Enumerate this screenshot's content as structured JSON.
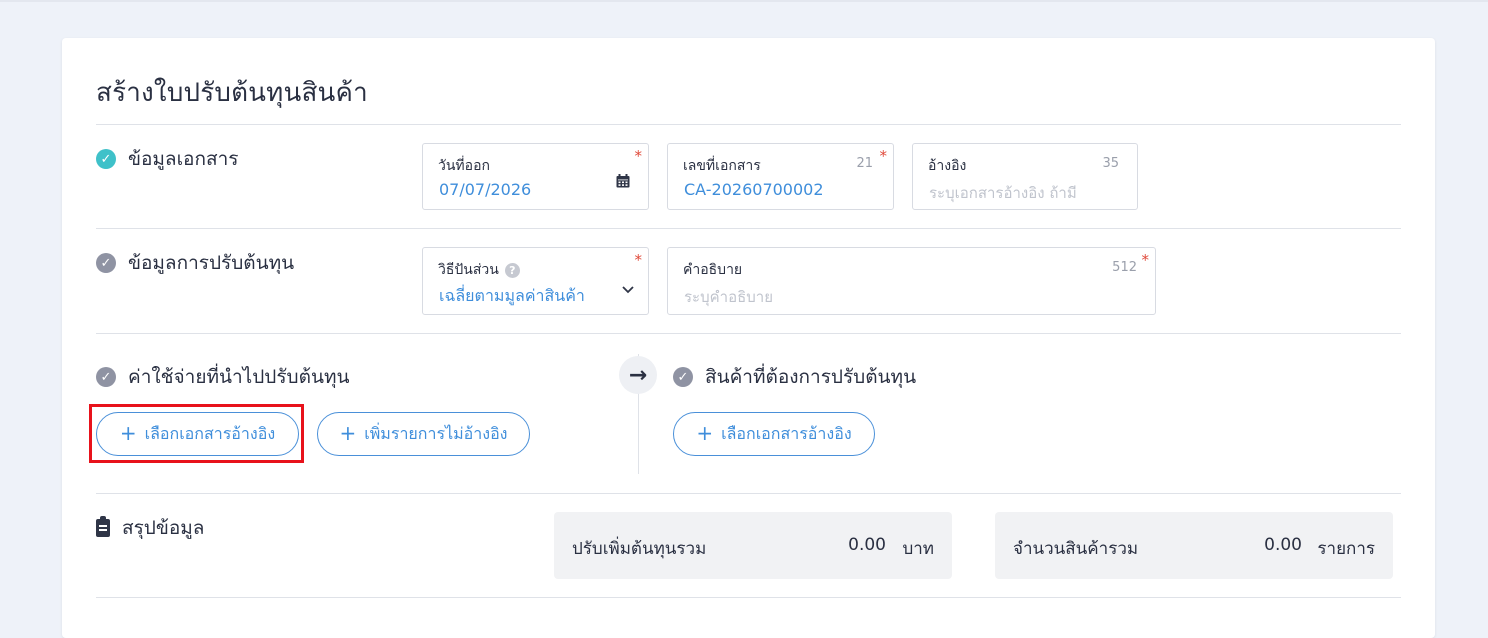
{
  "page": {
    "title": "สร้างใบปรับต้นทุนสินค้า"
  },
  "sections": {
    "document_info": {
      "label": "ข้อมูลเอกสาร",
      "status": "complete"
    },
    "adjust_info": {
      "label": "ข้อมูลการปรับต้นทุน",
      "status": "pending"
    },
    "expenses": {
      "label": "ค่าใช้จ่ายที่นำไปปรับต้นทุน",
      "status": "pending"
    },
    "products": {
      "label": "สินค้าที่ต้องการปรับต้นทุน",
      "status": "pending"
    },
    "summary": {
      "label": "สรุปข้อมูล"
    }
  },
  "fields": {
    "issue_date": {
      "label": "วันที่ออก",
      "value": "07/07/2026",
      "required": "*"
    },
    "doc_number": {
      "label": "เลขที่เอกสาร",
      "value": "CA-20260700002",
      "counter": "21",
      "required": "*"
    },
    "reference": {
      "label": "อ้างอิง",
      "placeholder": "ระบุเอกสารอ้างอิง ถ้ามี",
      "counter": "35"
    },
    "allocation_method": {
      "label": "วิธีปันส่วน",
      "value": "เฉลี่ยตามมูลค่าสินค้า",
      "required": "*"
    },
    "description": {
      "label": "คำอธิบาย",
      "placeholder": "ระบุคำอธิบาย",
      "counter": "512",
      "required": "*"
    }
  },
  "buttons": {
    "select_ref_doc": "เลือกเอกสารอ้างอิง",
    "add_unreferenced": "เพิ่มรายการไม่อ้างอิง",
    "select_ref_doc_products": "เลือกเอกสารอ้างอิง",
    "plus": "+"
  },
  "summary": {
    "total_increase": {
      "label": "ปรับเพิ่มต้นทุนรวม",
      "value": "0.00",
      "unit": "บาท"
    },
    "total_items": {
      "label": "จำนวนสินค้ารวม",
      "value": "0.00",
      "unit": "รายการ"
    }
  },
  "icons": {
    "check": "✓",
    "help": "?",
    "arrow": "→"
  },
  "colors": {
    "accent": "#3f8edb",
    "check_done": "#3fc1c9",
    "check_pending": "#8f93a3",
    "required": "#e04a3b",
    "highlight": "#e8121b"
  }
}
